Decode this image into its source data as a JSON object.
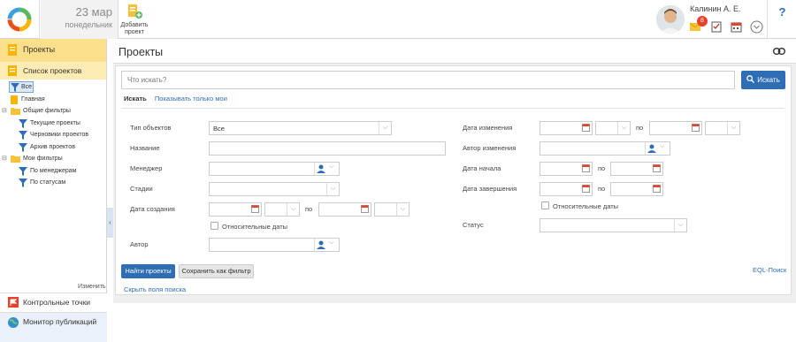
{
  "header": {
    "date_day": "23 мар",
    "date_weekday": "понедельник",
    "add_project_label": "Добавить проект",
    "user_name": "Калинин А. Е.",
    "notification_count": "8",
    "help_label": "?"
  },
  "sidebar": {
    "projects_label": "Проекты",
    "project_list_label": "Список проектов",
    "tree": [
      {
        "label": "Все",
        "icon": "filter-icon"
      },
      {
        "label": "Главная",
        "icon": "project-icon"
      },
      {
        "label": "Общие фильтры",
        "icon": "folder-icon"
      },
      {
        "label": "Текущие проекты",
        "icon": "filter-icon"
      },
      {
        "label": "Черновики проектов",
        "icon": "filter-icon"
      },
      {
        "label": "Архив проектов",
        "icon": "filter-icon"
      },
      {
        "label": "Мои фильтры",
        "icon": "folder-icon"
      },
      {
        "label": "По менеджерам",
        "icon": "filter-icon"
      },
      {
        "label": "По статусам",
        "icon": "filter-icon"
      }
    ],
    "edit_label": "Изменить",
    "bottom": [
      {
        "label": "Контрольные точки",
        "icon": "checkpoint-icon"
      },
      {
        "label": "Монитор публикаций",
        "icon": "globe-icon"
      }
    ]
  },
  "main": {
    "page_title": "Проекты",
    "search_placeholder": "Что искать?",
    "search_button": "Искать",
    "tabs": {
      "search": "Искать",
      "only_mine": "Показывать только мои"
    },
    "filters_left": {
      "object_type_label": "Тип объектов",
      "object_type_value": "Все",
      "name_label": "Название",
      "manager_label": "Менеджер",
      "stages_label": "Стадии",
      "created_label": "Дата создания",
      "po": "по",
      "relative_dates": "Относительные даты",
      "author_label": "Автор"
    },
    "filters_right": {
      "modified_label": "Дата изменения",
      "po": "по",
      "modified_author_label": "Автор изменения",
      "start_label": "Дата начала",
      "end_label": "Дата завершения",
      "relative_dates": "Относительные даты",
      "status_label": "Статус"
    },
    "find_button": "Найти проекты",
    "save_filter_button": "Сохранить как фильтр",
    "eql_link": "EQL-Поиск",
    "hide_fields_link": "Скрыть поля поиска"
  },
  "colors": {
    "accent": "#2f6db5",
    "active_nav": "#fcdf8a",
    "badge": "#e8412c"
  }
}
